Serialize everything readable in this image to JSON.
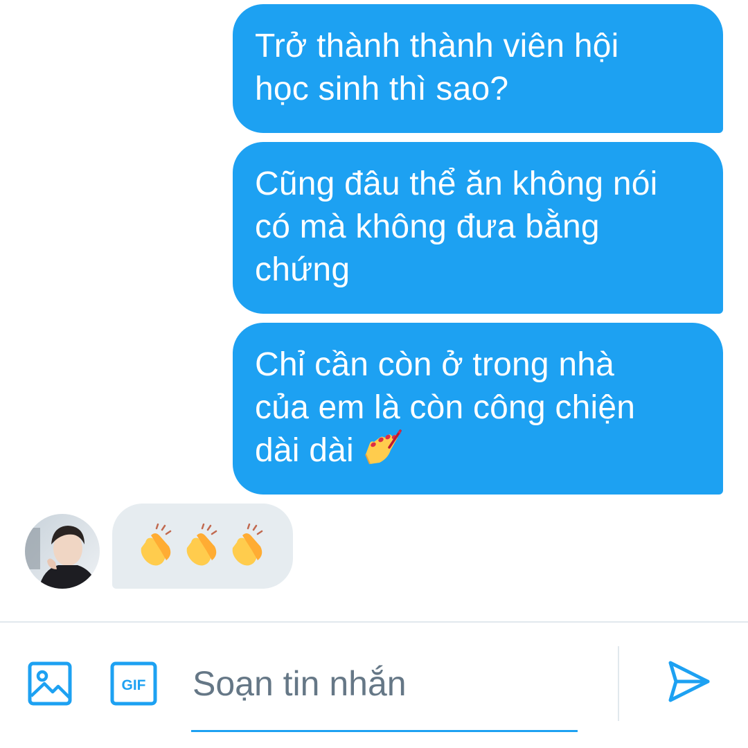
{
  "messages_out": [
    {
      "line1": "Trở thành thành viên hội",
      "line2": "học sinh thì sao?"
    },
    {
      "line1": "Cũng đâu thể ăn không nói",
      "line2": "có mà không đưa bằng",
      "line3": "chứng"
    },
    {
      "line1": "Chỉ cần còn ở trong nhà",
      "line2": "của em là còn công chiện",
      "line3": "dài dài",
      "emoji": "nail-polish"
    }
  ],
  "message_in": {
    "emojis": [
      "clapping-hands",
      "clapping-hands",
      "clapping-hands"
    ]
  },
  "composer": {
    "placeholder": "Soạn tin nhắn",
    "gif_label": "GIF",
    "icons": {
      "image": "image-icon",
      "gif": "gif-icon",
      "send": "send-icon"
    }
  },
  "colors": {
    "accent": "#1da1f2",
    "incoming_bubble": "#e6ecf0",
    "placeholder": "#657786"
  }
}
